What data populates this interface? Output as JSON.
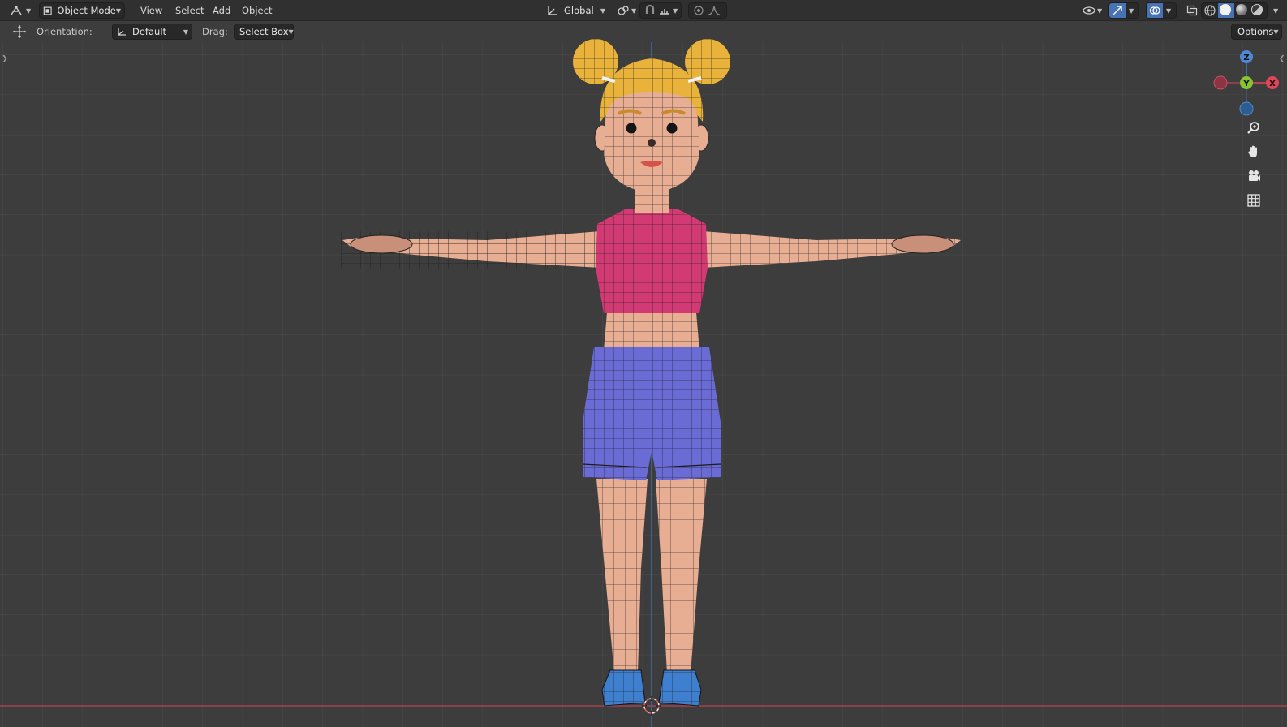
{
  "header": {
    "mode": "Object Mode",
    "menus": [
      "View",
      "Select",
      "Add",
      "Object"
    ],
    "transform_orientation": "Global",
    "options_label": "Options"
  },
  "tool_settings": {
    "orientation_label": "Orientation:",
    "orientation_value": "Default",
    "drag_label": "Drag:",
    "drag_value": "Select Box"
  },
  "gizmo": {
    "z": "Z",
    "y": "Y",
    "x": "X"
  },
  "icons": {
    "editor_type": "editor-type-icon",
    "mode": "object-mode-icon",
    "transform": "transform-orientation-icon",
    "pivot": "pivot-point-icon",
    "snap": "snap-icon",
    "proportional": "proportional-editing-icon",
    "visibility": "selectability-visibility-icon",
    "gizmos": "gizmos-icon",
    "overlays": "overlays-icon",
    "xray": "xray-icon",
    "wireframe": "wireframe-shading-icon",
    "solid": "solid-shading-icon",
    "material": "material-preview-icon",
    "rendered": "rendered-shading-icon",
    "zoom": "zoom-icon",
    "pan": "pan-hand-icon",
    "camera": "camera-view-icon",
    "ortho": "ortho-grid-icon",
    "move": "move-tool-icon"
  },
  "colors": {
    "viewport_bg": "#3d3d3d",
    "grid_line": "#4a4a4a",
    "x_axis": "#b84452",
    "z_axis": "#3a6ea8",
    "skin": "#e8ae93",
    "top": "#d23a74",
    "shorts": "#6b6bd6",
    "hair": "#e9b33b",
    "shoes": "#3f7fd0"
  }
}
